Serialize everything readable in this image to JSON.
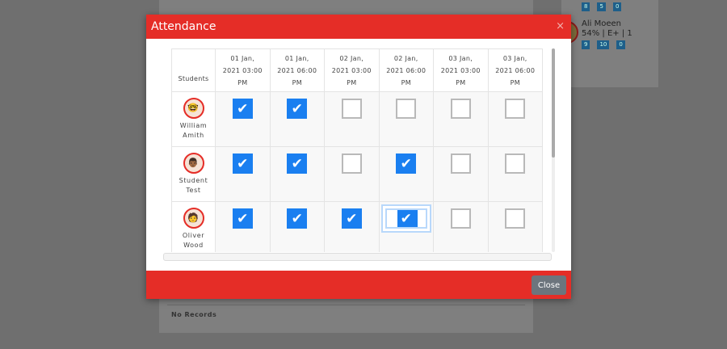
{
  "background": {
    "no_records": "No Records",
    "side_user": {
      "name": "Ali Moeen",
      "stats": "54% | E+ | 1",
      "badges": [
        "9",
        "10",
        "0"
      ]
    },
    "side_user_prev_badges": [
      "8",
      "5",
      "0"
    ]
  },
  "modal": {
    "title": "Attendance",
    "close_icon": "×",
    "close_label": "Close",
    "students_header": "Students",
    "columns": [
      {
        "l1": "01 Jan,",
        "l2": "2021 03:00",
        "l3": "PM"
      },
      {
        "l1": "01 Jan,",
        "l2": "2021 06:00",
        "l3": "PM"
      },
      {
        "l1": "02 Jan,",
        "l2": "2021 03:00",
        "l3": "PM"
      },
      {
        "l1": "02 Jan,",
        "l2": "2021 06:00",
        "l3": "PM"
      },
      {
        "l1": "03 Jan,",
        "l2": "2021 03:00",
        "l3": "PM"
      },
      {
        "l1": "03 Jan,",
        "l2": "2021 06:00",
        "l3": "PM"
      }
    ],
    "rows": [
      {
        "first": "William",
        "last": "Amith",
        "checks": [
          true,
          true,
          false,
          false,
          false,
          false
        ]
      },
      {
        "first": "Student",
        "last": "Test",
        "checks": [
          true,
          true,
          false,
          true,
          false,
          false
        ]
      },
      {
        "first": "Oliver",
        "last": "Wood",
        "checks": [
          true,
          true,
          true,
          true,
          false,
          false
        ]
      }
    ],
    "check_glyph": "✔",
    "accent": "#e52d27",
    "checkbox_color": "#1a7ff0"
  }
}
